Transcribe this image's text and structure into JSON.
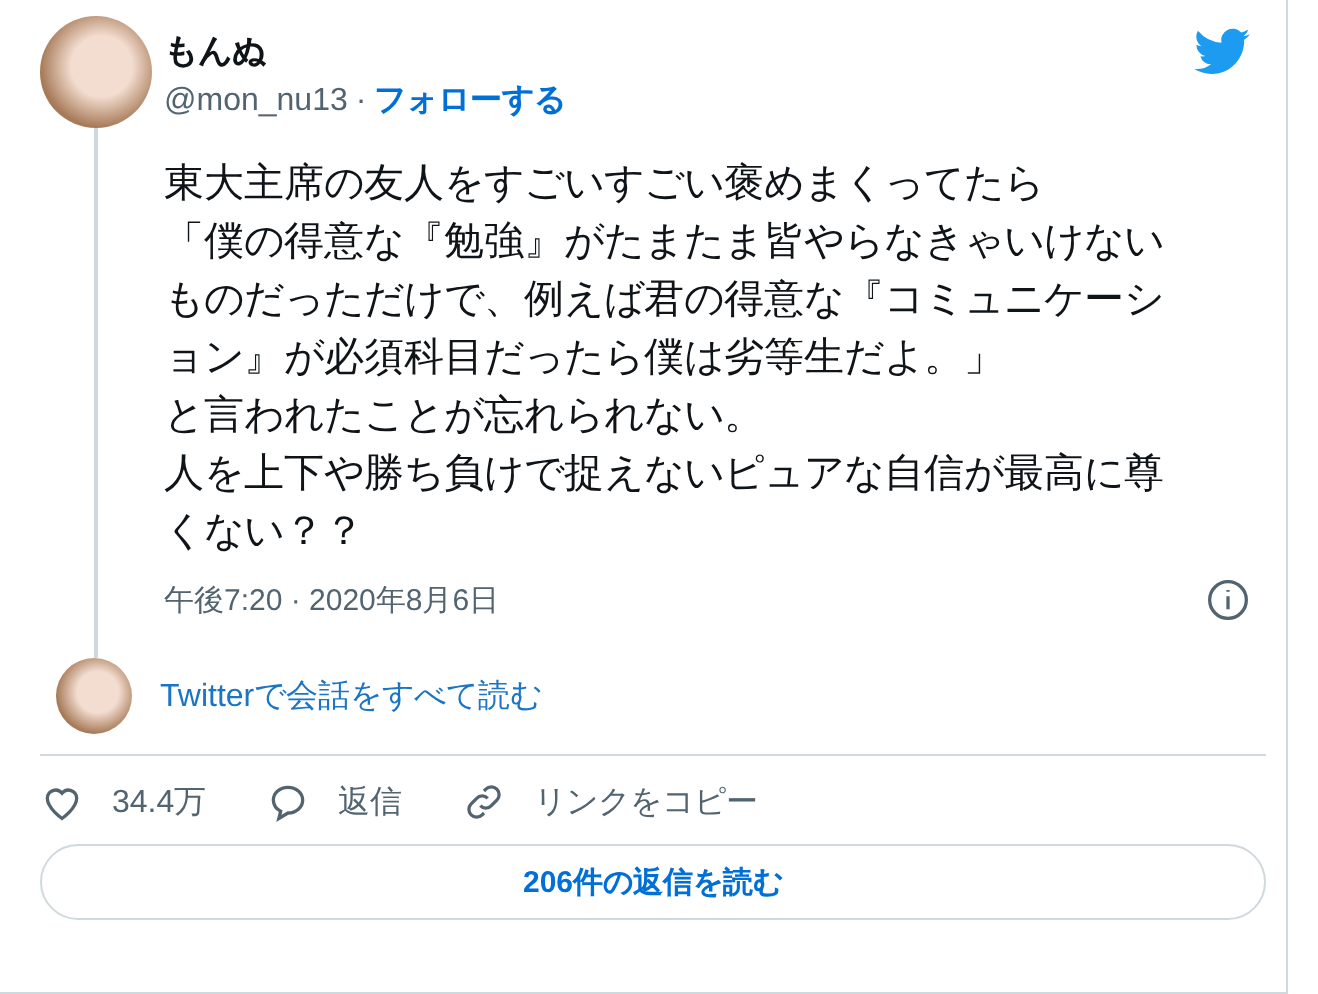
{
  "author": {
    "name": "もんぬ",
    "handle": "@mon_nu13",
    "separator": "·",
    "follow": "フォローする"
  },
  "tweet": {
    "paragraphs": [
      "東大主席の友人をすごいすごい褒めまくってたら",
      "「僕の得意な『勉強』がたまたま皆やらなきゃいけないものだっただけで、例えば君の得意な『コミュニケーション』が必須科目だったら僕は劣等生だよ。」",
      "と言われたことが忘れられない。",
      "人を上下や勝ち負けで捉えないピュアな自信が最高に尊くない？？"
    ],
    "timestamp": "午後7:20 · 2020年8月6日"
  },
  "conversation_link": "Twitterで会話をすべて読む",
  "actions": [
    {
      "kind": "like",
      "label": "34.4万"
    },
    {
      "kind": "reply",
      "label": "返信"
    },
    {
      "kind": "link",
      "label": "リンクをコピー"
    }
  ],
  "read_replies": "206件の返信を読む"
}
